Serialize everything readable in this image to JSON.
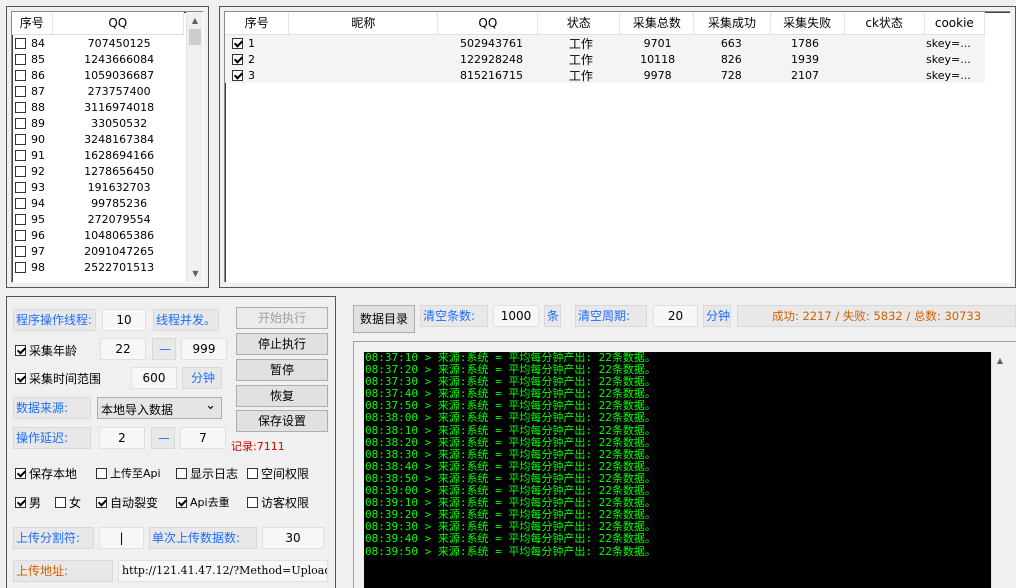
{
  "left_list": {
    "headers": [
      "序号",
      "QQ"
    ],
    "rows": [
      {
        "no": "84",
        "qq": "707450125"
      },
      {
        "no": "85",
        "qq": "1243666084"
      },
      {
        "no": "86",
        "qq": "1059036687"
      },
      {
        "no": "87",
        "qq": "273757400"
      },
      {
        "no": "88",
        "qq": "3116974018"
      },
      {
        "no": "89",
        "qq": "33050532"
      },
      {
        "no": "90",
        "qq": "3248167384"
      },
      {
        "no": "91",
        "qq": "1628694166"
      },
      {
        "no": "92",
        "qq": "1278656450"
      },
      {
        "no": "93",
        "qq": "191632703"
      },
      {
        "no": "94",
        "qq": "99785236"
      },
      {
        "no": "95",
        "qq": "272079554"
      },
      {
        "no": "96",
        "qq": "1048065386"
      },
      {
        "no": "97",
        "qq": "2091047265"
      },
      {
        "no": "98",
        "qq": "2522701513"
      }
    ]
  },
  "acct_table": {
    "headers": [
      "序号",
      "昵称",
      "QQ",
      "状态",
      "采集总数",
      "采集成功",
      "采集失败",
      "ck状态",
      "cookie"
    ],
    "rows": [
      {
        "no": "1",
        "nick": "",
        "qq": "502943761",
        "status": "工作",
        "total": "9701",
        "ok": "663",
        "fail": "1786",
        "ck": "",
        "cookie": "skey=..."
      },
      {
        "no": "2",
        "nick": "",
        "qq": "122928248",
        "status": "工作",
        "total": "10118",
        "ok": "826",
        "fail": "1939",
        "ck": "",
        "cookie": "skey=..."
      },
      {
        "no": "3",
        "nick": "",
        "qq": "815216715",
        "status": "工作",
        "total": "9978",
        "ok": "728",
        "fail": "2107",
        "ck": "",
        "cookie": "skey=..."
      }
    ]
  },
  "settings": {
    "threads_label": "程序操作线程:",
    "threads_value": "10",
    "concurrency_label": "线程并发。",
    "age_label": "采集年龄",
    "age_min": "22",
    "age_max": "999",
    "dash": "—",
    "time_range_label": "采集时间范围",
    "time_range_value": "600",
    "minute_label": "分钟",
    "source_label": "数据来源:",
    "source_value": "本地导入数据",
    "delay_label": "操作延迟:",
    "delay_min": "2",
    "delay_max": "7",
    "record_label": "记录:7111",
    "save_local_label": "保存本地",
    "upload_api_label": "上传至Api",
    "show_log_label": "显示日志",
    "space_perm_label": "空间权限",
    "male_label": "男",
    "female_label": "女",
    "auto_split_label": "自动裂变",
    "api_dedup_label": "Api去重",
    "visitor_perm_label": "访客权限",
    "upload_sep_label": "上传分割符:",
    "upload_sep_value": "|",
    "per_upload_label": "单次上传数据数:",
    "per_upload_value": "30",
    "upload_url_label": "上传地址:",
    "upload_url_value": "http://121.41.47.12/?Method=Upload&"
  },
  "buttons": {
    "start": "开始执行",
    "stop": "停止执行",
    "pause": "暂停",
    "resume": "恢复",
    "save": "保存设置"
  },
  "log_bar": {
    "dir_button": "数据目录",
    "clear_count_label": "清空条数:",
    "clear_count_value": "1000",
    "unit_items": "条",
    "clear_period_label": "清空周期:",
    "clear_period_value": "20",
    "unit_minute": "分钟",
    "stats": "成功: 2217 / 失败: 5832 / 总数: 30733"
  },
  "log_lines": [
    "08:37:10 > 来源:系统 = 平均每分钟产出: 22条数据。",
    "08:37:20 > 来源:系统 = 平均每分钟产出: 22条数据。",
    "08:37:30 > 来源:系统 = 平均每分钟产出: 22条数据。",
    "08:37:40 > 来源:系统 = 平均每分钟产出: 22条数据。",
    "08:37:50 > 来源:系统 = 平均每分钟产出: 22条数据。",
    "08:38:00 > 来源:系统 = 平均每分钟产出: 22条数据。",
    "08:38:10 > 来源:系统 = 平均每分钟产出: 22条数据。",
    "08:38:20 > 来源:系统 = 平均每分钟产出: 22条数据。",
    "08:38:30 > 来源:系统 = 平均每分钟产出: 22条数据。",
    "08:38:40 > 来源:系统 = 平均每分钟产出: 22条数据。",
    "08:38:50 > 来源:系统 = 平均每分钟产出: 22条数据。",
    "08:39:00 > 来源:系统 = 平均每分钟产出: 22条数据。",
    "08:39:10 > 来源:系统 = 平均每分钟产出: 22条数据。",
    "08:39:20 > 来源:系统 = 平均每分钟产出: 22条数据。",
    "08:39:30 > 来源:系统 = 平均每分钟产出: 22条数据。",
    "08:39:40 > 来源:系统 = 平均每分钟产出: 22条数据。",
    "08:39:50 > 来源:系统 = 平均每分钟产出: 22条数据。"
  ],
  "colors": {
    "accent_blue": "#1e6cff",
    "stats_orange": "#d06000",
    "record_red": "#d00000",
    "log_green": "#00ff00"
  },
  "icons": {
    "scroll_up": "▲",
    "scroll_down": "▼",
    "dropdown": "⌄"
  }
}
